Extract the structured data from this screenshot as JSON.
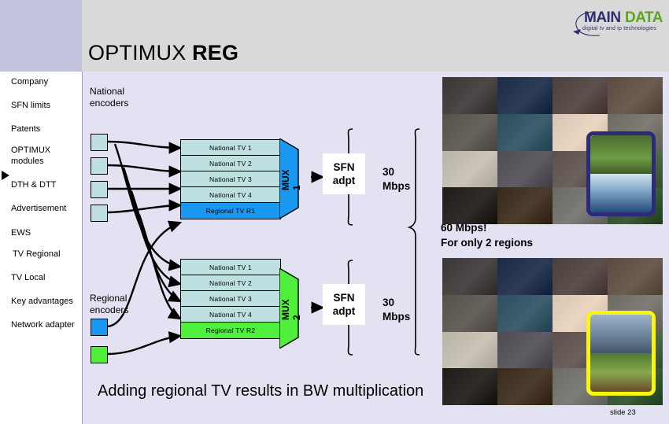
{
  "header": {
    "title_regular": "OPTIMUX ",
    "title_bold": "REG",
    "logo": {
      "main": "MAIN",
      "data": "DATA",
      "tagline": "digital tv and ip technologies"
    }
  },
  "sidebar": {
    "items": [
      {
        "label": "Company",
        "selected": false
      },
      {
        "label": "SFN limits",
        "selected": false
      },
      {
        "label": "Patents",
        "selected": false
      },
      {
        "label": "OPTIMUX",
        "selected": false
      },
      {
        "label": "modules",
        "selected": false
      },
      {
        "label": "DTH & DTT",
        "selected": false
      },
      {
        "label": "Advertisement",
        "selected": false
      },
      {
        "label": "EWS",
        "selected": false
      },
      {
        "label": "TV Regional",
        "selected": true
      },
      {
        "label": "TV Local",
        "selected": false
      },
      {
        "label": "Key advantages",
        "selected": false
      },
      {
        "label": "Network adapter",
        "selected": false
      }
    ]
  },
  "diagram": {
    "national_encoders_label": "National\nencoders",
    "national_encoders_line1": "National",
    "national_encoders_line2": "encoders",
    "regional_encoders_line1": "Regional",
    "regional_encoders_line2": "encoders",
    "mux1": {
      "name": "MUX 1",
      "color": "#1898f0",
      "services": [
        {
          "label": "National TV 1",
          "kind": "national"
        },
        {
          "label": "National TV 2",
          "kind": "national"
        },
        {
          "label": "National TV 3",
          "kind": "national"
        },
        {
          "label": "National TV 4",
          "kind": "national"
        },
        {
          "label": "Regional TV R1",
          "kind": "regional1"
        }
      ],
      "sfn_line1": "SFN",
      "sfn_line2": "adpt",
      "rate_line1": "30",
      "rate_line2": "Mbps"
    },
    "mux2": {
      "name": "MUX 2",
      "color": "#50ef3c",
      "services": [
        {
          "label": "National TV 1",
          "kind": "national"
        },
        {
          "label": "National TV 2",
          "kind": "national"
        },
        {
          "label": "National TV 3",
          "kind": "national"
        },
        {
          "label": "National TV 4",
          "kind": "national"
        },
        {
          "label": "Regional TV R2",
          "kind": "regional2"
        }
      ],
      "sfn_line1": "SFN",
      "sfn_line2": "adpt",
      "rate_line1": "30",
      "rate_line2": "Mbps"
    },
    "total_line1": "60 Mbps!",
    "total_line2": "For only 2 regions",
    "encoder_colors": {
      "national": "#bfe0e0",
      "regional_1": "#1898f0",
      "regional_2": "#50ef3c"
    }
  },
  "footer": {
    "caption": "Adding regional TV results in BW multiplication",
    "slide_label": "slide  23"
  },
  "collages": {
    "top": {
      "highlight_color": "#2b2b7a",
      "tiles": [
        "#3a3636",
        "#1b2a45",
        "#4a3f3a",
        "#5a4a40",
        "#56504b",
        "#2c4d5e",
        "#d9c4b2",
        "#6d6a63",
        "#b9b2a6",
        "#4e4a52",
        "#5a4f4a",
        "#3f5a3a",
        "#1e1a18",
        "#3a2a1c",
        "#6a6a66",
        "#2a4a2a"
      ]
    },
    "bottom": {
      "highlight_color": "#f6f612",
      "tiles": [
        "#3a3636",
        "#1b2a45",
        "#4a3f3a",
        "#5a4a40",
        "#56504b",
        "#2c4d5e",
        "#d9c4b2",
        "#6d6a63",
        "#b9b2a6",
        "#4e4a52",
        "#5a4f4a",
        "#3f5a3a",
        "#1e1a18",
        "#3a2a1c",
        "#6a6a66",
        "#2a4a2a"
      ]
    }
  }
}
